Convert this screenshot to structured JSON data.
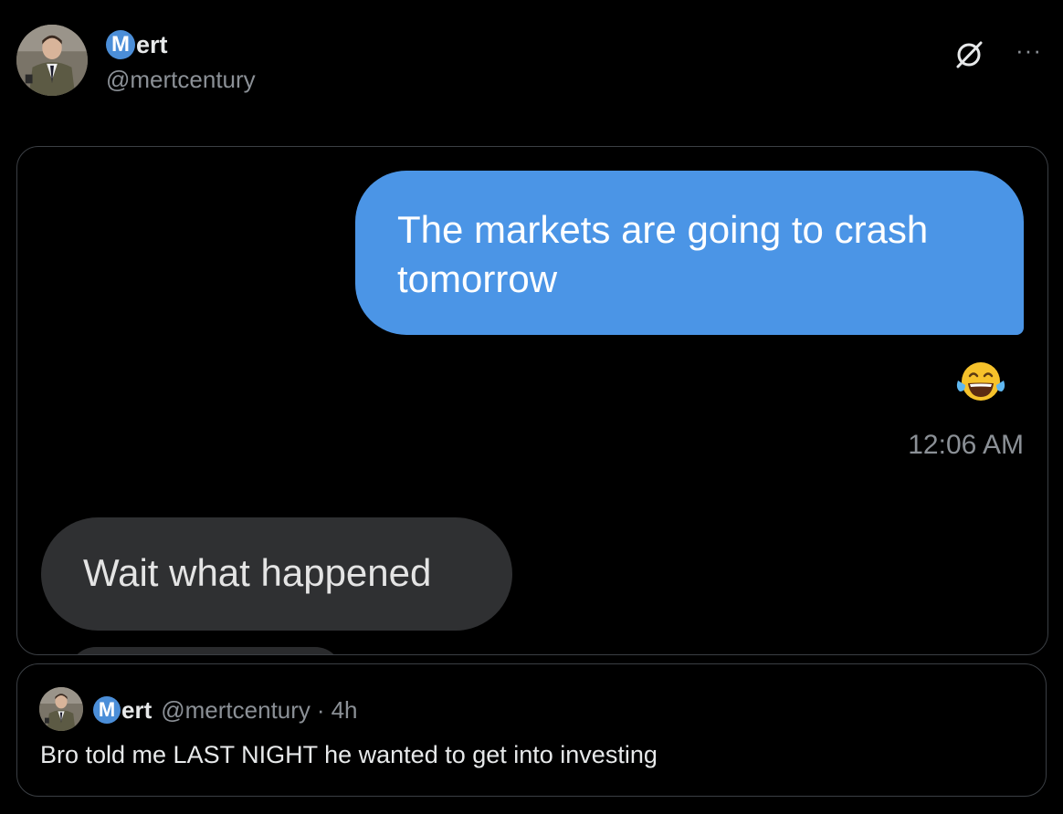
{
  "post": {
    "author": {
      "name_initial": "M",
      "name_rest": "ert",
      "handle": "@mertcentury",
      "avatar_icon": "avatar-portrait-man-in-suit"
    },
    "actions": {
      "grok_icon": "grok-slash-circle-icon",
      "more_icon": "more-dots-icon",
      "more_label": "···"
    }
  },
  "media": {
    "outgoing_message": "The markets are going to crash tomorrow",
    "outgoing_color": "#4b95e6",
    "reaction": "😂",
    "timestamp": "12:06 AM",
    "incoming_message": "Wait what happened",
    "incoming_color": "#2f3032"
  },
  "quote": {
    "author": {
      "name_initial": "M",
      "name_rest": "ert",
      "handle": "@mertcentury"
    },
    "separator": "·",
    "time": "4h",
    "text": "Bro told me LAST NIGHT he wanted to get into investing"
  },
  "colors": {
    "background": "#000000",
    "badge": "#4b8ed8",
    "muted_text": "#8b9096",
    "border": "#3b3f44"
  }
}
